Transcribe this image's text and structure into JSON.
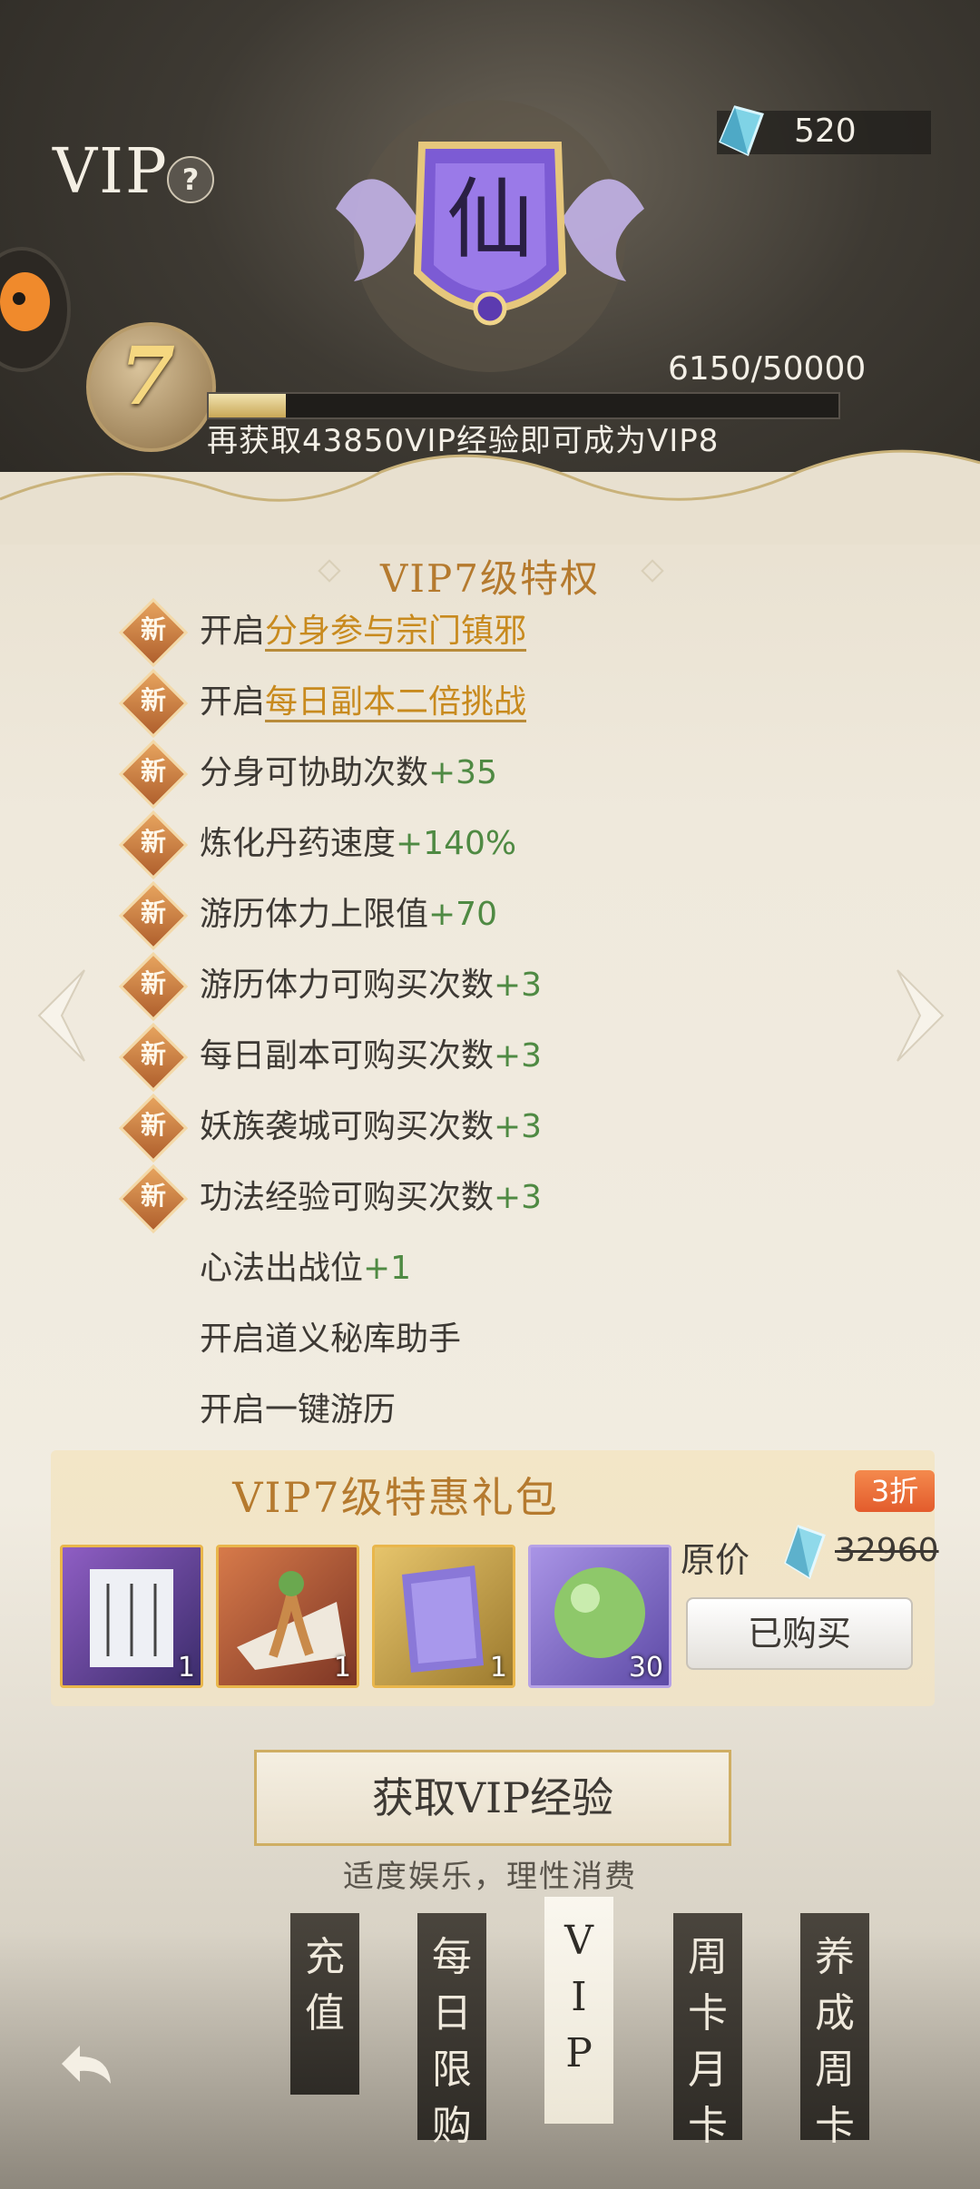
{
  "header": {
    "title": "VIP",
    "help_icon_text": "?",
    "currency": {
      "icon": "spirit-stone-icon",
      "amount": "520"
    }
  },
  "vip_status": {
    "emblem_char": "仙",
    "level": "7",
    "xp_text": "6150/50000",
    "xp_progress": 0.123,
    "hint": "再获取43850VIP经验即可成为VIP8"
  },
  "privileges": {
    "title": "VIP7级特权",
    "new_badge_text": "新",
    "items": [
      {
        "prefix": "开启",
        "highlight": "分身参与宗门镇邪",
        "bonus": "",
        "new": true
      },
      {
        "prefix": "开启",
        "highlight": "每日副本二倍挑战",
        "bonus": "",
        "new": true
      },
      {
        "prefix": "分身可协助次数",
        "highlight": "",
        "bonus": "+35",
        "new": true
      },
      {
        "prefix": "炼化丹药速度",
        "highlight": "",
        "bonus": "+140%",
        "new": true
      },
      {
        "prefix": "游历体力上限值",
        "highlight": "",
        "bonus": "+70",
        "new": true
      },
      {
        "prefix": "游历体力可购买次数",
        "highlight": "",
        "bonus": "+3",
        "new": true
      },
      {
        "prefix": "每日副本可购买次数",
        "highlight": "",
        "bonus": "+3",
        "new": true
      },
      {
        "prefix": "妖族袭城可购买次数",
        "highlight": "",
        "bonus": "+3",
        "new": true
      },
      {
        "prefix": "功法经验可购买次数",
        "highlight": "",
        "bonus": "+3",
        "new": true
      },
      {
        "prefix": "心法出战位",
        "highlight": "",
        "bonus": "+1",
        "new": false
      },
      {
        "prefix": "开启道义秘库助手",
        "highlight": "",
        "bonus": "",
        "new": false
      },
      {
        "prefix": "开启一键游历",
        "highlight": "",
        "bonus": "",
        "new": false
      }
    ]
  },
  "gift_pack": {
    "title": "VIP7级特惠礼包",
    "discount": "3折",
    "original_label": "原价",
    "original_price": "32960",
    "bought_label": "已购买",
    "items": [
      {
        "icon": "scroll-book-icon",
        "count": "1"
      },
      {
        "icon": "ginseng-root-icon",
        "count": "1"
      },
      {
        "icon": "cultivation-book-icon",
        "count": "1"
      },
      {
        "icon": "green-orb-icon",
        "count": "30"
      }
    ]
  },
  "get_vip_button": "获取VIP经验",
  "tagline": "适度娱乐，理性消费",
  "tabs": [
    {
      "label": "充值",
      "active": false
    },
    {
      "label": "每日限购",
      "active": false
    },
    {
      "label": "VIP",
      "active": true
    },
    {
      "label": "周卡月卡",
      "active": false
    },
    {
      "label": "养成周卡",
      "active": false
    }
  ],
  "colors": {
    "accent": "#b57a2e",
    "highlight": "#c88a1e",
    "bonus": "#4f8a43"
  }
}
